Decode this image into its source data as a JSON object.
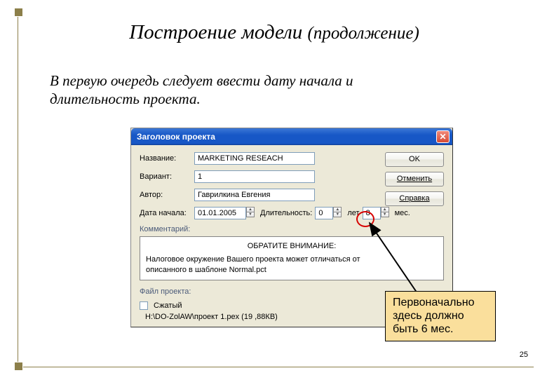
{
  "slide": {
    "title_main": "Построение модели",
    "title_sub": "(продолжение)",
    "page_number": "25"
  },
  "body": {
    "line1": "В первую очередь следует ввести дату начала и",
    "line2": "длительность проекта."
  },
  "dialog": {
    "title": "Заголовок проекта",
    "buttons": {
      "ok": "OK",
      "cancel": "Отменить",
      "help": "Справка"
    },
    "labels": {
      "name": "Название:",
      "variant": "Вариант:",
      "author": "Автор:",
      "date": "Дата начала:",
      "duration": "Длительность:",
      "years_unit": "лет",
      "months_unit": "мес.",
      "comment": "Комментарий:",
      "file": "Файл проекта:",
      "packed": "Сжатый"
    },
    "values": {
      "name": "MARKETING RESEACH",
      "variant": "1",
      "author": "Гаврилкина Евгения",
      "date": "01.01.2005",
      "years": "0",
      "months": "8",
      "path": "H:\\DO-ZolAW\\проект 1.pex (19 ,88КВ)"
    },
    "panel": {
      "heading": "ОБРАТИТЕ ВНИМАНИЕ:",
      "text1": "Налоговое окружение Вашего проекта может отличаться от",
      "text2": "описанного в шаблоне Normal.pct"
    }
  },
  "callout": {
    "line1": "Первоначально",
    "line2": "здесь должно",
    "line3": "быть 6 мес."
  }
}
